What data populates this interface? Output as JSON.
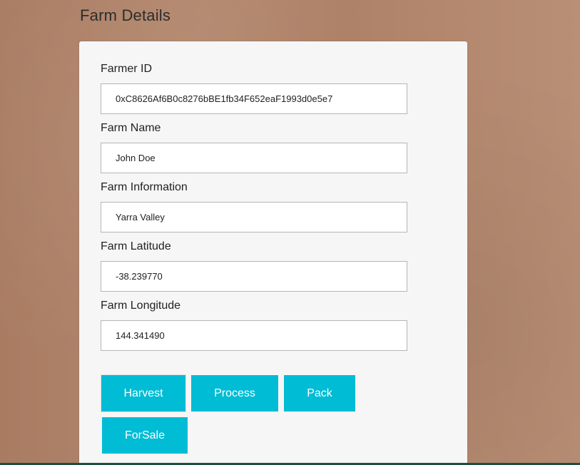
{
  "page": {
    "title": "Farm Details"
  },
  "fields": [
    {
      "label": "Farmer ID",
      "value": "0xC8626Af6B0c8276bBE1fb34F652eaF1993d0e5e7"
    },
    {
      "label": "Farm Name",
      "value": "John Doe"
    },
    {
      "label": "Farm Information",
      "value": "Yarra Valley"
    },
    {
      "label": "Farm Latitude",
      "value": "-38.239770"
    },
    {
      "label": "Farm Longitude",
      "value": "144.341490"
    }
  ],
  "buttons": {
    "harvest": "Harvest",
    "process": "Process",
    "pack": "Pack",
    "forsale": "ForSale"
  },
  "colors": {
    "button_bg": "#00bcd4",
    "card_bg": "#f6f6f6",
    "page_bg": "#b0846a"
  }
}
